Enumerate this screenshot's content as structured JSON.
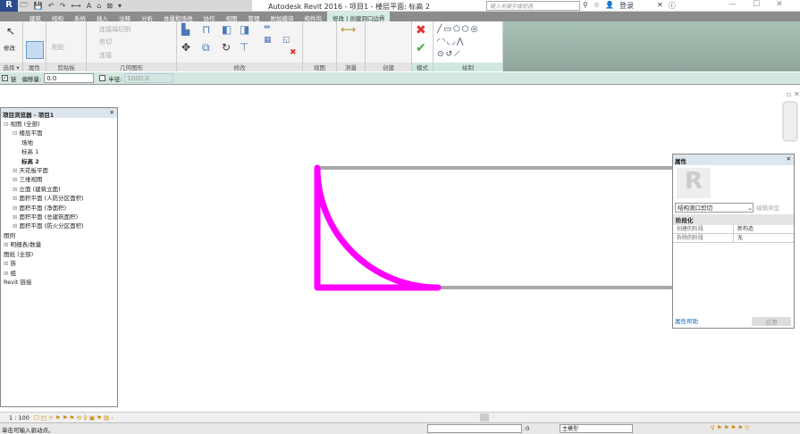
{
  "app": {
    "title": "Autodesk Revit 2016 -    项目1 - 楼层平面: 标高 2",
    "search_placeholder": "键入关键字或短语",
    "login": "登录"
  },
  "tabs": [
    "建筑",
    "结构",
    "系统",
    "插入",
    "注释",
    "分析",
    "体量和场地",
    "协作",
    "视图",
    "管理",
    "附加模块",
    "构件坞",
    "修改 | 创建洞口边界"
  ],
  "ribbon": {
    "modify_label": "修改",
    "panels": [
      "选择 ▾",
      "属性",
      "剪贴板",
      "几何图形",
      "修改",
      "视图",
      "测量",
      "创建",
      "模式",
      "绘制"
    ],
    "paste": "粘贴",
    "cut_join": "连接端切割",
    "cut": "剪切",
    "join": "连接"
  },
  "options": {
    "chain_label": "链",
    "chain_checked": true,
    "offset_label": "偏移量:",
    "offset_value": "0.0",
    "radius_label": "半径:",
    "radius_checked": false,
    "radius_value": "1000.0"
  },
  "browser": {
    "title": "项目浏览器 - 项目1",
    "items": [
      {
        "label": "视图 (全部)",
        "level": 0,
        "prefix": "⊟"
      },
      {
        "label": "楼层平面",
        "level": 1,
        "prefix": "⊟"
      },
      {
        "label": "场地",
        "level": 2,
        "prefix": ""
      },
      {
        "label": "标高 1",
        "level": 2,
        "prefix": ""
      },
      {
        "label": "标高 2",
        "level": 2,
        "prefix": "",
        "bold": true
      },
      {
        "label": "天花板平面",
        "level": 1,
        "prefix": "⊞"
      },
      {
        "label": "三维视图",
        "level": 1,
        "prefix": "⊞"
      },
      {
        "label": "立面 (建筑立面)",
        "level": 1,
        "prefix": "⊞"
      },
      {
        "label": "面积平面 (人防分区面积)",
        "level": 1,
        "prefix": "⊞"
      },
      {
        "label": "面积平面 (净面积)",
        "level": 1,
        "prefix": "⊞"
      },
      {
        "label": "面积平面 (总建筑面积)",
        "level": 1,
        "prefix": "⊞"
      },
      {
        "label": "面积平面 (防火分区面积)",
        "level": 1,
        "prefix": "⊞"
      },
      {
        "label": "图例",
        "level": 0,
        "prefix": ""
      },
      {
        "label": "明细表/数量",
        "level": 0,
        "prefix": "⊞"
      },
      {
        "label": "图纸 (全部)",
        "level": 0,
        "prefix": ""
      },
      {
        "label": "族",
        "level": 0,
        "prefix": "⊞"
      },
      {
        "label": "组",
        "level": 0,
        "prefix": "⊞"
      },
      {
        "label": "Revit 链接",
        "level": 0,
        "prefix": ""
      }
    ]
  },
  "properties": {
    "title": "属性",
    "type": "结构洞口剪切",
    "edit_type": "编辑类型",
    "group": "阶段化",
    "rows": [
      [
        "创建的阶段",
        "新构造"
      ],
      [
        "拆除的阶段",
        "无"
      ]
    ],
    "help": "属性帮助",
    "apply": "应用"
  },
  "viewbar": {
    "scale": "1 : 100"
  },
  "status": {
    "message": "单击可输入驱动点。",
    "workset_value": ":0",
    "model": "主模型"
  },
  "colors": {
    "sketch": "#ff00ff",
    "ribbon_accent": "#d3ece3"
  }
}
